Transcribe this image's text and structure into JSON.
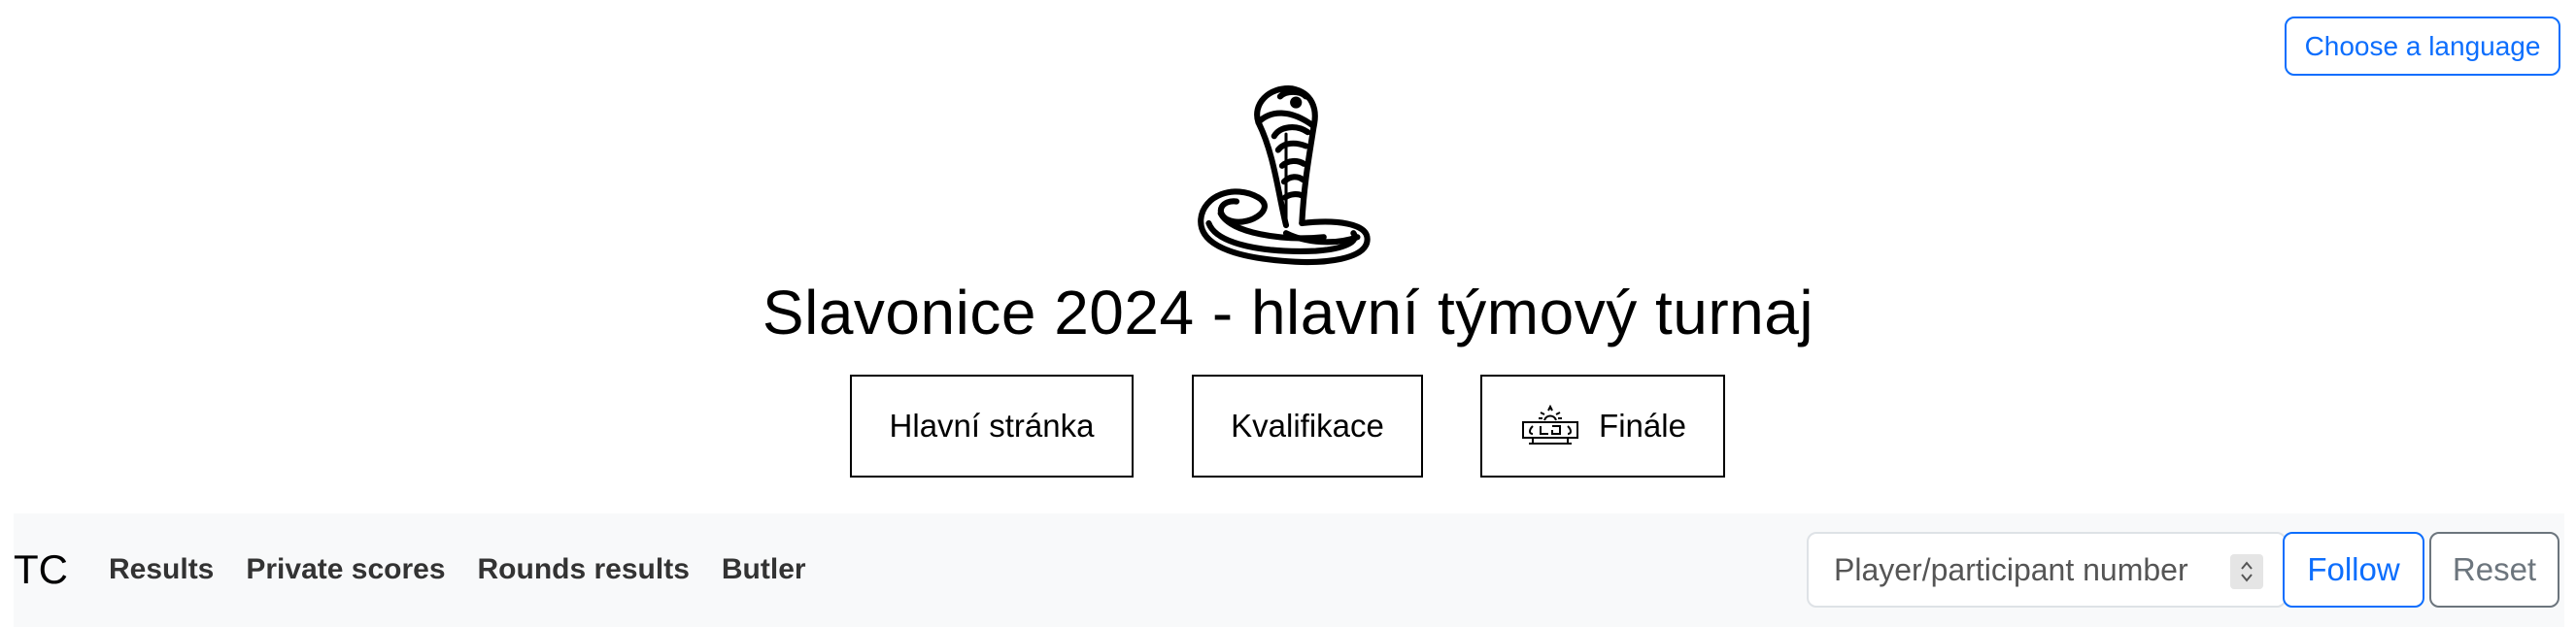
{
  "language_button": "Choose a language",
  "logo_icon": "cobra-snake-icon",
  "title": "Slavonice 2024 - hlavní týmový turnaj",
  "tournament_nav": [
    {
      "label": "Hlavní stránka"
    },
    {
      "label": "Kvalifikace"
    },
    {
      "label": "Finále",
      "icon": "trophy-stars-icon"
    }
  ],
  "navbar": {
    "brand": "TC",
    "links": [
      "Results",
      "Private scores",
      "Rounds results",
      "Butler"
    ],
    "search": {
      "placeholder": "Player/participant number"
    },
    "follow_label": "Follow",
    "reset_label": "Reset"
  },
  "colors": {
    "primary": "#0d6efd",
    "secondary": "#6c757d",
    "navbar_bg": "#f8f9fa"
  }
}
